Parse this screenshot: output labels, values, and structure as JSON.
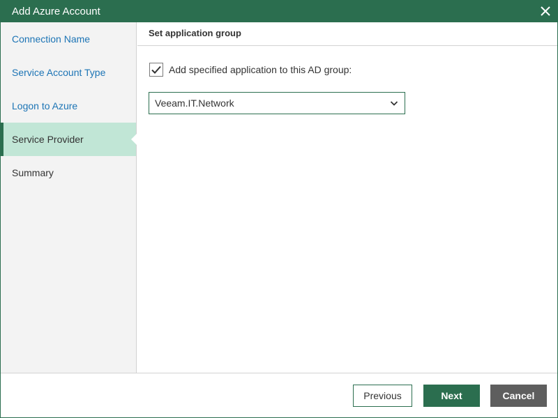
{
  "window": {
    "title": "Add Azure Account",
    "close_icon": "close-icon"
  },
  "sidebar": {
    "items": [
      {
        "label": "Connection Name",
        "state": "completed"
      },
      {
        "label": "Service Account Type",
        "state": "completed"
      },
      {
        "label": "Logon to Azure",
        "state": "completed"
      },
      {
        "label": "Service Provider",
        "state": "current"
      },
      {
        "label": "Summary",
        "state": "future"
      }
    ]
  },
  "main": {
    "section_title": "Set application group",
    "checkbox": {
      "label": "Add specified application to this AD group:",
      "checked": true
    },
    "group_select": {
      "value": "Veeam.IT.Network",
      "icon": "chevron-down-icon"
    }
  },
  "footer": {
    "previous_label": "Previous",
    "next_label": "Next",
    "cancel_label": "Cancel"
  },
  "colors": {
    "brand": "#2b6e4f",
    "current_step_bg": "#c1e6d6",
    "link": "#1c74b5",
    "cancel_bg": "#5e5e5e"
  }
}
